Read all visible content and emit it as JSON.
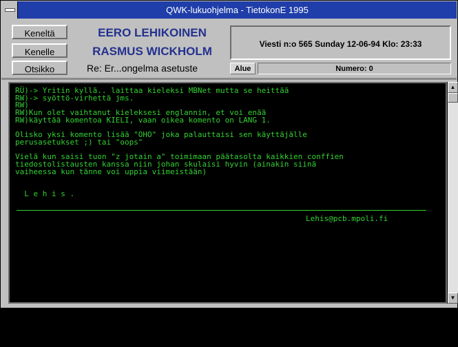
{
  "window": {
    "title": "QWK-lukuohjelma  - TietokonE 1995"
  },
  "header": {
    "from_label": "Keneltä",
    "to_label": "Kenelle",
    "subject_label": "Otsikko",
    "from_name": "EERO LEHIKOINEN",
    "to_name": "RASMUS WICKHOLM",
    "subject": "Re: Er...ongelma asetuste",
    "message_info": "Viesti n:o  565 Sunday 12-06-94  Klo: 23:33",
    "area_label": "Alue",
    "number_label": "Numero: 0"
  },
  "message": {
    "body": "RÜ)-> Yritin kyllä.. laittaa kieleksi MBNet mutta se heittää\nRW)-> syöttö-virhettä jms.\nRW)\nRW)Kun olet vaihtanut kieleksesi englannin, et voi enää\nRW)käyttää komentoa KIELI, vaan oikea komento on LANG 1.\n\nOlisko yksi komento lisää \"OHO\" joka palauttaisi sen käyttäjälle\nperusasetukset ;) tai \"oops\"\n\nVielä kun saisi tuon \"z jotain a\" toimimaan päätasolta kaikkien conffien\ntiedostolistausten kanssa niin johan skulaisi hyvin (ainakin siinä\nvaiheessa kun tänne voi uppia viimeistään)\n\n\n  L e h i s .",
    "signature_email": "Lehis@pcb.mpoli.fi"
  },
  "scrollbar": {
    "up_glyph": "▲",
    "down_glyph": "▼"
  },
  "colors": {
    "titlebar": "#1f3ea9",
    "name_text": "#23318f",
    "terminal_text": "#33d133",
    "terminal_bg": "#000000"
  }
}
